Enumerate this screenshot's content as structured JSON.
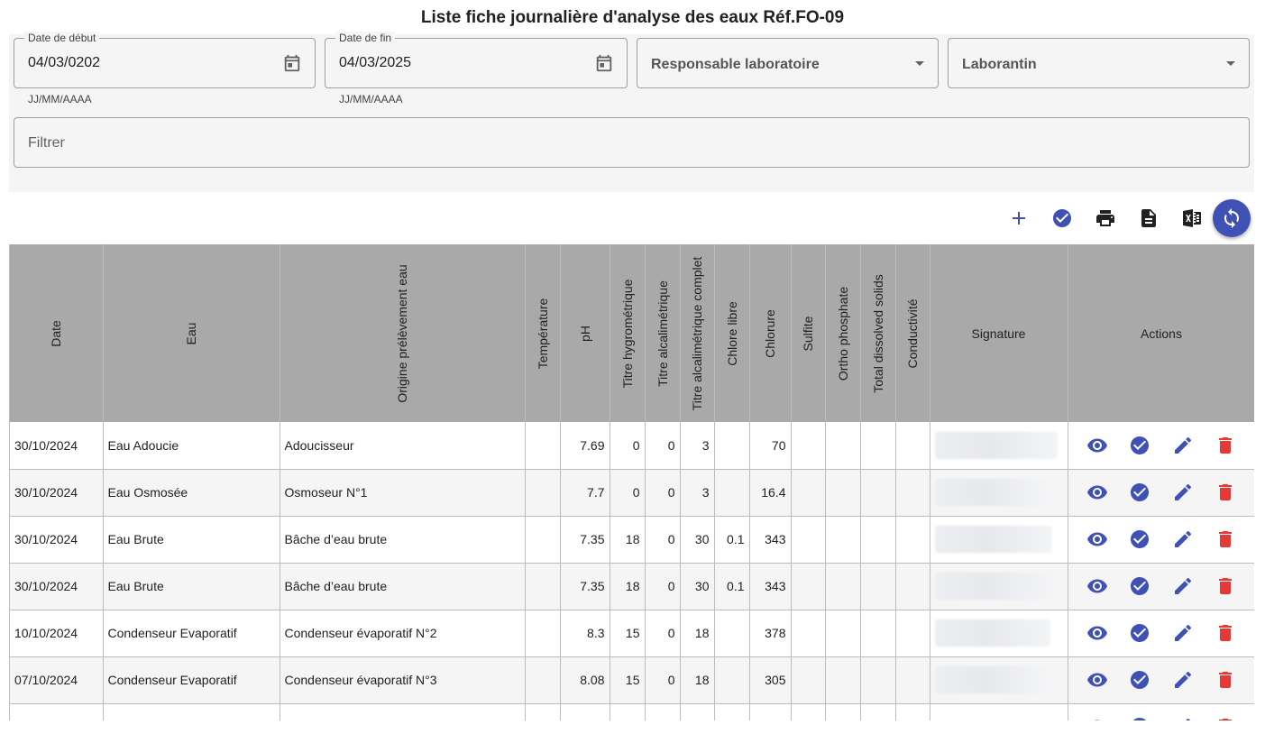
{
  "page": {
    "title": "Liste fiche journalière d'analyse des eaux Réf.FO-09"
  },
  "filters": {
    "start_date": {
      "label": "Date de début",
      "value": "04/03/0202",
      "helper": "JJ/MM/AAAA"
    },
    "end_date": {
      "label": "Date de fin",
      "value": "04/03/2025",
      "helper": "JJ/MM/AAAA"
    },
    "responsable": {
      "label": "Responsable laboratoire"
    },
    "laborantin": {
      "label": "Laborantin"
    },
    "filter_placeholder": "Filtrer"
  },
  "toolbar": {
    "icons": [
      "add-icon",
      "check-circle-icon",
      "print-icon",
      "document-icon",
      "excel-icon",
      "sync-icon"
    ]
  },
  "colors": {
    "accent": "#3f51b5",
    "danger": "#e53935",
    "header_bg": "#a9a9a9"
  },
  "table": {
    "columns": [
      "Date",
      "Eau",
      "Origine prélèvement eau",
      "Température",
      "pH",
      "Titre hygrométrique",
      "Titre alcalimétrique",
      "Titre alcalimétrique complet",
      "Chlore libre",
      "Chlorure",
      "Sulfite",
      "Ortho phosphate",
      "Total dissolved solids",
      "Conductivité",
      "Signature",
      "Actions"
    ],
    "rows": [
      {
        "date": "30/10/2024",
        "eau": "Eau Adoucie",
        "origine": "Adoucisseur",
        "temperature": "",
        "ph": "7.69",
        "th": "0",
        "ta": "0",
        "tac": "3",
        "chlore": "",
        "chlorure": "70",
        "sulfite": "",
        "ortho": "",
        "tds": "",
        "conductivite": ""
      },
      {
        "date": "30/10/2024",
        "eau": "Eau Osmosée",
        "origine": "Osmoseur N°1",
        "temperature": "",
        "ph": "7.7",
        "th": "0",
        "ta": "0",
        "tac": "3",
        "chlore": "",
        "chlorure": "16.4",
        "sulfite": "",
        "ortho": "",
        "tds": "",
        "conductivite": ""
      },
      {
        "date": "30/10/2024",
        "eau": "Eau Brute",
        "origine": "Bâche d’eau brute",
        "temperature": "",
        "ph": "7.35",
        "th": "18",
        "ta": "0",
        "tac": "30",
        "chlore": "0.1",
        "chlorure": "343",
        "sulfite": "",
        "ortho": "",
        "tds": "",
        "conductivite": ""
      },
      {
        "date": "30/10/2024",
        "eau": "Eau Brute",
        "origine": "Bâche d’eau brute",
        "temperature": "",
        "ph": "7.35",
        "th": "18",
        "ta": "0",
        "tac": "30",
        "chlore": "0.1",
        "chlorure": "343",
        "sulfite": "",
        "ortho": "",
        "tds": "",
        "conductivite": ""
      },
      {
        "date": "10/10/2024",
        "eau": "Condenseur Evaporatif",
        "origine": "Condenseur évaporatif N°2",
        "temperature": "",
        "ph": "8.3",
        "th": "15",
        "ta": "0",
        "tac": "18",
        "chlore": "",
        "chlorure": "378",
        "sulfite": "",
        "ortho": "",
        "tds": "",
        "conductivite": ""
      },
      {
        "date": "07/10/2024",
        "eau": "Condenseur Evaporatif",
        "origine": "Condenseur évaporatif N°3",
        "temperature": "",
        "ph": "8.08",
        "th": "15",
        "ta": "0",
        "tac": "18",
        "chlore": "",
        "chlorure": "305",
        "sulfite": "",
        "ortho": "",
        "tds": "",
        "conductivite": ""
      },
      {
        "date": "",
        "eau": "",
        "origine": "",
        "temperature": "",
        "ph": "",
        "th": "",
        "ta": "",
        "tac": "",
        "chlore": "",
        "chlorure": "",
        "sulfite": "",
        "ortho": "",
        "tds": "",
        "conductivite": ""
      }
    ]
  }
}
